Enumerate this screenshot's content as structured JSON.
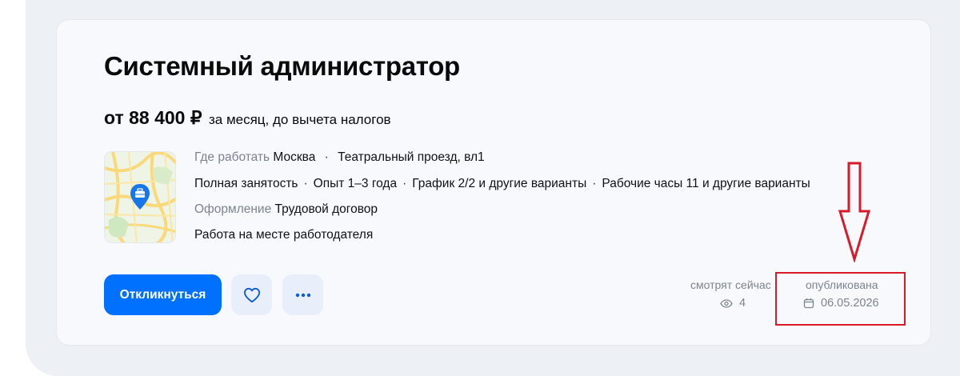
{
  "vacancy": {
    "title": "Системный администратор",
    "salary_amount": "от 88 400 ₽",
    "salary_note": "за месяц, до вычета налогов",
    "where_label": "Где работать",
    "city": "Москва",
    "address": "Театральный проезд, вл1",
    "employment": "Полная занятость",
    "experience": "Опыт 1–3 года",
    "schedule": "График 2/2 и другие варианты",
    "hours": "Рабочие часы 11 и другие варианты",
    "contract_label": "Оформление",
    "contract": "Трудовой договор",
    "work_format": "Работа на месте работодателя"
  },
  "actions": {
    "apply_label": "Откликнуться",
    "favorite_icon": "heart-icon",
    "more_icon": "more-dots-icon"
  },
  "stats": {
    "watching_label": "смотрят сейчас",
    "watching_count": "4",
    "published_label": "опубликована",
    "published_date": "06.05.2026"
  },
  "annotation": {
    "color": "#d81b2a",
    "shape": "red arrow pointing down to highlighted publication date"
  },
  "colors": {
    "primary": "#0070ff",
    "muted_text": "#7c8490",
    "card_bg": "#f7f9fc"
  }
}
